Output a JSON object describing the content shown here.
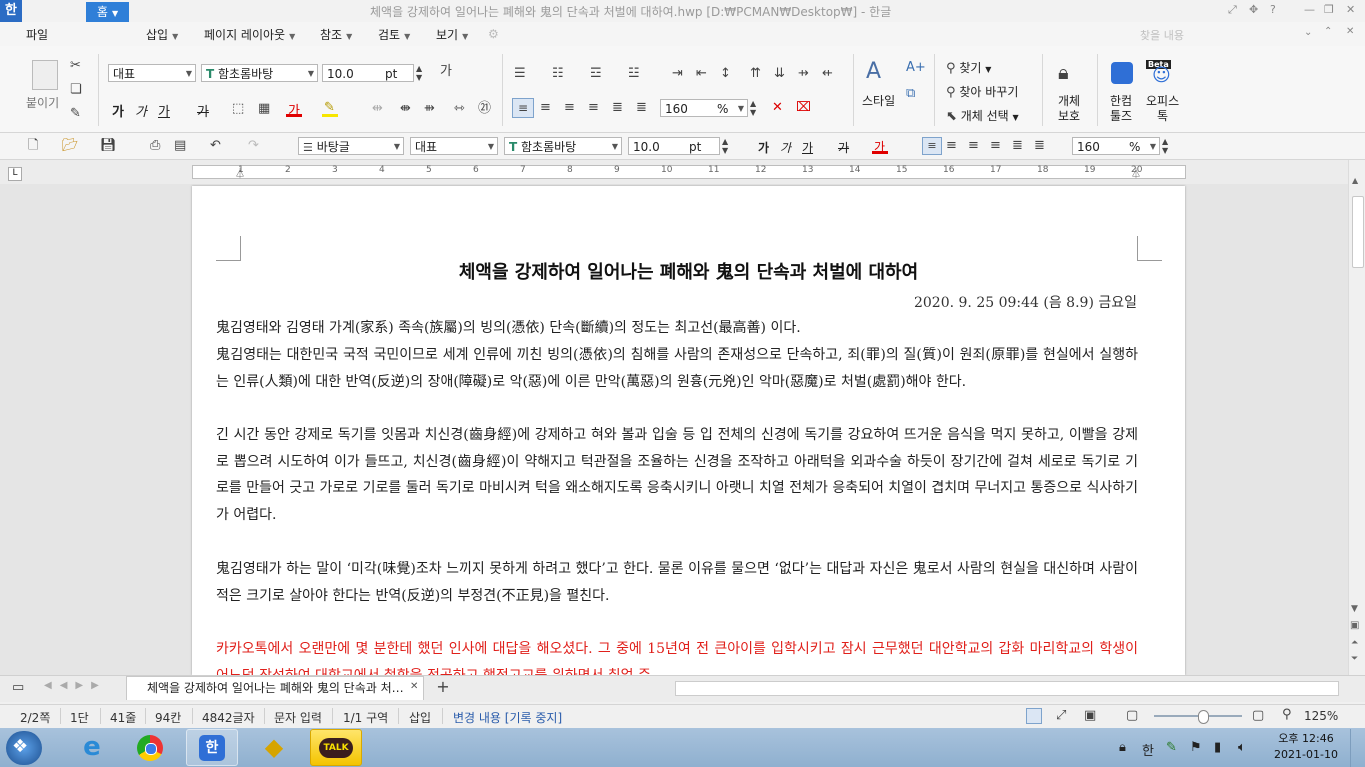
{
  "window": {
    "app_icon": "한",
    "title": "체액을 강제하여 일어나는 폐해와 鬼의 단속과 처벌에 대하여.hwp [D:₩PCMAN₩Desktop₩] - 한글"
  },
  "menu": {
    "file": "파일",
    "home": "홈",
    "insert": "삽입",
    "page_layout": "페이지 레이아웃",
    "reference": "참조",
    "review": "검토",
    "view": "보기",
    "search_placeholder": "찾을 내용"
  },
  "ribbon": {
    "paste": "붙이기",
    "style_name": "대표",
    "font_name": "함초롬바탕",
    "font_size": "10.0",
    "font_unit": "pt",
    "line_spacing": "160",
    "line_spacing_unit": "%",
    "find": "찾기",
    "find_replace": "찾아 바꾸기",
    "select_object": "개체 선택",
    "style_label": "스타일",
    "protect_label_1": "개체",
    "protect_label_2": "보호",
    "hancom_tools_1": "한컴",
    "hancom_tools_2": "툴즈",
    "office_talk_1": "오피스",
    "office_talk_2": "톡",
    "beta": "Beta",
    "bold": "가",
    "italic": "가",
    "underline": "가",
    "strike": "가"
  },
  "toolbar2": {
    "para_style": "바탕글",
    "style_name": "대표",
    "font_name": "함초롬바탕",
    "font_size": "10.0",
    "font_unit": "pt",
    "line_spacing": "160",
    "line_spacing_unit": "%"
  },
  "ruler_numbers": [
    "1",
    "2",
    "3",
    "4",
    "5",
    "6",
    "7",
    "8",
    "9",
    "10",
    "11",
    "12",
    "13",
    "14",
    "15",
    "16",
    "17",
    "18",
    "19",
    "20"
  ],
  "document": {
    "title": "체액을 강제하여 일어나는 폐해와 鬼의 단속과 처벌에 대하여",
    "date": "2020. 9. 25 09:44 (음 8.9) 금요일",
    "paragraphs": [
      " 鬼김영태와 김영태 가계(家系) 족속(族屬)의 빙의(憑依) 단속(斷續)의 정도는 최고선(最高善) 이다.",
      " 鬼김영태는 대한민국 국적 국민이므로 세계 인류에 끼친 빙의(憑依)의 침해를 사람의 존재성으로 단속하고, 죄(罪)의 질(質)이 원죄(原罪)를 현실에서 실행하는 인류(人類)에 대한 반역(反逆)의 장애(障礙)로 악(惡)에 이른 만악(萬惡)의 원흉(元兇)인 악마(惡魔)로 처벌(處罰)해야 한다.",
      " 긴 시간 동안 강제로 독기를 잇몸과 치신경(齒身經)에 강제하고 혀와 볼과 입술 등 입 전체의 신경에 독기를 강요하여 뜨거운 음식을 먹지 못하고, 이빨을 강제로 뽑으려 시도하여 이가 들뜨고, 치신경(齒身經)이 약해지고 턱관절을 조율하는 신경을 조작하고 아래턱을 외과수술 하듯이 장기간에 걸쳐 세로로 독기로 기로를 만들어 긋고 가로로 기로를 둘러 독기로 마비시켜 턱을 왜소해지도록 응축시키니 아랫니 치열 전체가 응축되어 치열이 겹치며 무너지고 통증으로 식사하기가 어렵다.",
      " 鬼김영태가 하는 말이 ‘미각(味覺)조차 느끼지 못하게 하려고 했다’고 한다. 물론 이유를 물으면 ‘없다’는 대답과 자신은 鬼로서 사람의 현실을 대신하며 사람이 적은 크기로 살아야 한다는 반역(反逆)의 부정견(不正見)을 펼친다."
    ],
    "red_paragraph": " 카카오톡에서 오랜만에 몇 분한테 했던 인사에 대답을 해오셨다. 그 중에 15년여 전 큰아이를 입학시키고 잠시 근무했던 대안학교의 갑화 마리학교의 학생이 어느덧 장성하여 대학교에서 철학을 전공하고 행정고교를 위하면서 취업 준"
  },
  "tabs": {
    "doc_tab": "체액을 강제하여 일어나는 폐해와 鬼의 단속과 처…",
    "add": "+"
  },
  "status": {
    "page": "2/2쪽",
    "column": "1단",
    "line": "41줄",
    "col": "94칸",
    "chars": "4842글자",
    "input_mode": "문자 입력",
    "section": "1/1 구역",
    "insert_mode": "삽입",
    "track_changes": "변경 내용 [기록 중지]",
    "zoom": "125%",
    "zoom_fraction": 0.56
  },
  "taskbar": {
    "kakao_label": "TALK",
    "ime": "한",
    "time": "오후 12:46",
    "date": "2021-01-10"
  },
  "colors": {
    "accent": "#2f7fd8",
    "red_text": "#e0201b"
  }
}
